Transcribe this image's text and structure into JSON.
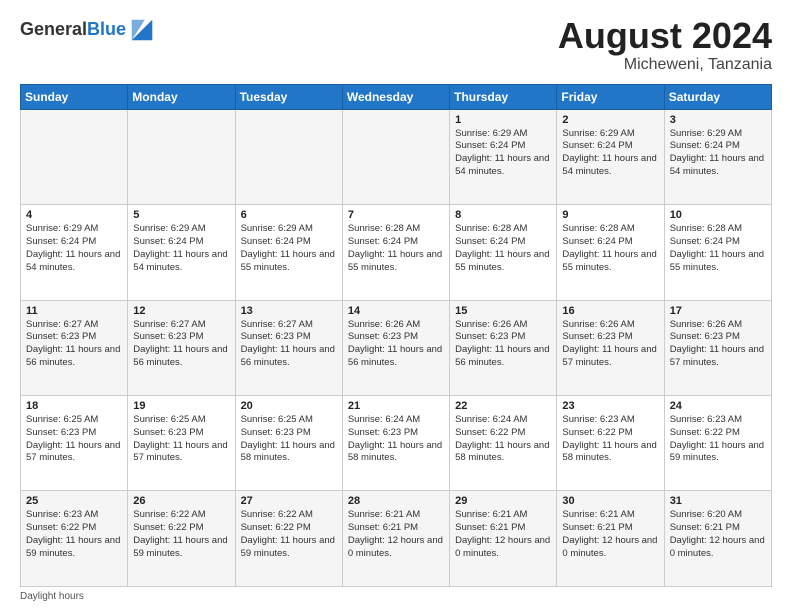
{
  "header": {
    "logo_line1": "General",
    "logo_line2": "Blue",
    "month_year": "August 2024",
    "location": "Micheweni, Tanzania"
  },
  "weekdays": [
    "Sunday",
    "Monday",
    "Tuesday",
    "Wednesday",
    "Thursday",
    "Friday",
    "Saturday"
  ],
  "weeks": [
    [
      {
        "day": "",
        "info": ""
      },
      {
        "day": "",
        "info": ""
      },
      {
        "day": "",
        "info": ""
      },
      {
        "day": "",
        "info": ""
      },
      {
        "day": "1",
        "info": "Sunrise: 6:29 AM\nSunset: 6:24 PM\nDaylight: 11 hours and 54 minutes."
      },
      {
        "day": "2",
        "info": "Sunrise: 6:29 AM\nSunset: 6:24 PM\nDaylight: 11 hours and 54 minutes."
      },
      {
        "day": "3",
        "info": "Sunrise: 6:29 AM\nSunset: 6:24 PM\nDaylight: 11 hours and 54 minutes."
      }
    ],
    [
      {
        "day": "4",
        "info": "Sunrise: 6:29 AM\nSunset: 6:24 PM\nDaylight: 11 hours and 54 minutes."
      },
      {
        "day": "5",
        "info": "Sunrise: 6:29 AM\nSunset: 6:24 PM\nDaylight: 11 hours and 54 minutes."
      },
      {
        "day": "6",
        "info": "Sunrise: 6:29 AM\nSunset: 6:24 PM\nDaylight: 11 hours and 55 minutes."
      },
      {
        "day": "7",
        "info": "Sunrise: 6:28 AM\nSunset: 6:24 PM\nDaylight: 11 hours and 55 minutes."
      },
      {
        "day": "8",
        "info": "Sunrise: 6:28 AM\nSunset: 6:24 PM\nDaylight: 11 hours and 55 minutes."
      },
      {
        "day": "9",
        "info": "Sunrise: 6:28 AM\nSunset: 6:24 PM\nDaylight: 11 hours and 55 minutes."
      },
      {
        "day": "10",
        "info": "Sunrise: 6:28 AM\nSunset: 6:24 PM\nDaylight: 11 hours and 55 minutes."
      }
    ],
    [
      {
        "day": "11",
        "info": "Sunrise: 6:27 AM\nSunset: 6:23 PM\nDaylight: 11 hours and 56 minutes."
      },
      {
        "day": "12",
        "info": "Sunrise: 6:27 AM\nSunset: 6:23 PM\nDaylight: 11 hours and 56 minutes."
      },
      {
        "day": "13",
        "info": "Sunrise: 6:27 AM\nSunset: 6:23 PM\nDaylight: 11 hours and 56 minutes."
      },
      {
        "day": "14",
        "info": "Sunrise: 6:26 AM\nSunset: 6:23 PM\nDaylight: 11 hours and 56 minutes."
      },
      {
        "day": "15",
        "info": "Sunrise: 6:26 AM\nSunset: 6:23 PM\nDaylight: 11 hours and 56 minutes."
      },
      {
        "day": "16",
        "info": "Sunrise: 6:26 AM\nSunset: 6:23 PM\nDaylight: 11 hours and 57 minutes."
      },
      {
        "day": "17",
        "info": "Sunrise: 6:26 AM\nSunset: 6:23 PM\nDaylight: 11 hours and 57 minutes."
      }
    ],
    [
      {
        "day": "18",
        "info": "Sunrise: 6:25 AM\nSunset: 6:23 PM\nDaylight: 11 hours and 57 minutes."
      },
      {
        "day": "19",
        "info": "Sunrise: 6:25 AM\nSunset: 6:23 PM\nDaylight: 11 hours and 57 minutes."
      },
      {
        "day": "20",
        "info": "Sunrise: 6:25 AM\nSunset: 6:23 PM\nDaylight: 11 hours and 58 minutes."
      },
      {
        "day": "21",
        "info": "Sunrise: 6:24 AM\nSunset: 6:23 PM\nDaylight: 11 hours and 58 minutes."
      },
      {
        "day": "22",
        "info": "Sunrise: 6:24 AM\nSunset: 6:22 PM\nDaylight: 11 hours and 58 minutes."
      },
      {
        "day": "23",
        "info": "Sunrise: 6:23 AM\nSunset: 6:22 PM\nDaylight: 11 hours and 58 minutes."
      },
      {
        "day": "24",
        "info": "Sunrise: 6:23 AM\nSunset: 6:22 PM\nDaylight: 11 hours and 59 minutes."
      }
    ],
    [
      {
        "day": "25",
        "info": "Sunrise: 6:23 AM\nSunset: 6:22 PM\nDaylight: 11 hours and 59 minutes."
      },
      {
        "day": "26",
        "info": "Sunrise: 6:22 AM\nSunset: 6:22 PM\nDaylight: 11 hours and 59 minutes."
      },
      {
        "day": "27",
        "info": "Sunrise: 6:22 AM\nSunset: 6:22 PM\nDaylight: 11 hours and 59 minutes."
      },
      {
        "day": "28",
        "info": "Sunrise: 6:21 AM\nSunset: 6:21 PM\nDaylight: 12 hours and 0 minutes."
      },
      {
        "day": "29",
        "info": "Sunrise: 6:21 AM\nSunset: 6:21 PM\nDaylight: 12 hours and 0 minutes."
      },
      {
        "day": "30",
        "info": "Sunrise: 6:21 AM\nSunset: 6:21 PM\nDaylight: 12 hours and 0 minutes."
      },
      {
        "day": "31",
        "info": "Sunrise: 6:20 AM\nSunset: 6:21 PM\nDaylight: 12 hours and 0 minutes."
      }
    ]
  ],
  "footer": {
    "note": "Daylight hours"
  }
}
